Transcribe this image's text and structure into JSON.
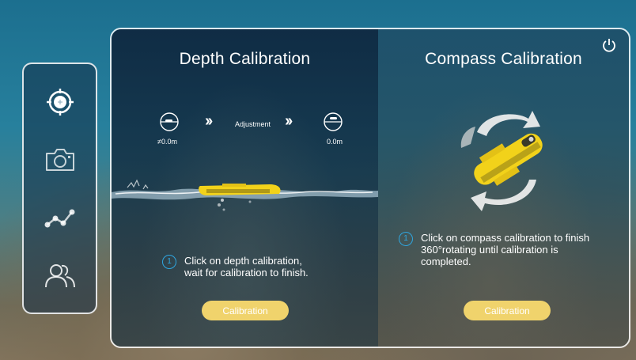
{
  "sidebar": {
    "items": [
      {
        "name": "calibration-target-icon",
        "active": true
      },
      {
        "name": "camera-icon",
        "active": false
      },
      {
        "name": "graph-icon",
        "active": false
      },
      {
        "name": "users-icon",
        "active": false
      }
    ]
  },
  "depth": {
    "title": "Depth Calibration",
    "start_label": "≠0.0m",
    "adjust_label": "Adjustment",
    "end_label": "0.0m",
    "step_number": "1",
    "step_line1": "Click on depth calibration,",
    "step_line2": "wait for calibration to finish.",
    "button_label": "Calibration"
  },
  "compass": {
    "title": "Compass Calibration",
    "step_number": "1",
    "step_line1": "Click on compass calibration to finish",
    "step_line2": "360°rotating until calibration is",
    "step_line3": "completed.",
    "button_label": "Calibration"
  },
  "colors": {
    "accent": "#f0d36c",
    "step_blue": "#2fa6e0",
    "drone_yellow": "#f2d21a"
  }
}
